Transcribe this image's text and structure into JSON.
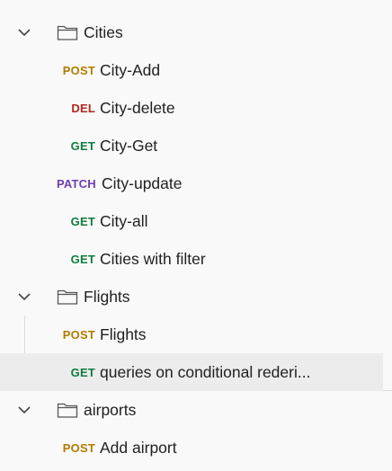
{
  "tree": {
    "cities": {
      "label": "Cities",
      "requests": [
        {
          "method": "POST",
          "label": "City-Add"
        },
        {
          "method": "DEL",
          "label": "City-delete"
        },
        {
          "method": "GET",
          "label": "City-Get"
        },
        {
          "method": "PATCH",
          "label": "City-update"
        },
        {
          "method": "GET",
          "label": "City-all"
        },
        {
          "method": "GET",
          "label": "Cities with filter"
        }
      ]
    },
    "flights": {
      "label": "Flights",
      "requests": [
        {
          "method": "POST",
          "label": "Flights"
        },
        {
          "method": "GET",
          "label": "queries on conditional rederi..."
        }
      ]
    },
    "airports": {
      "label": "airports",
      "requests": [
        {
          "method": "POST",
          "label": "Add airport"
        }
      ]
    }
  },
  "colors": {
    "post": "#b07c00",
    "del": "#b3261e",
    "get": "#107c41",
    "patch": "#6f3fb0",
    "selected_bg": "#ececec"
  }
}
